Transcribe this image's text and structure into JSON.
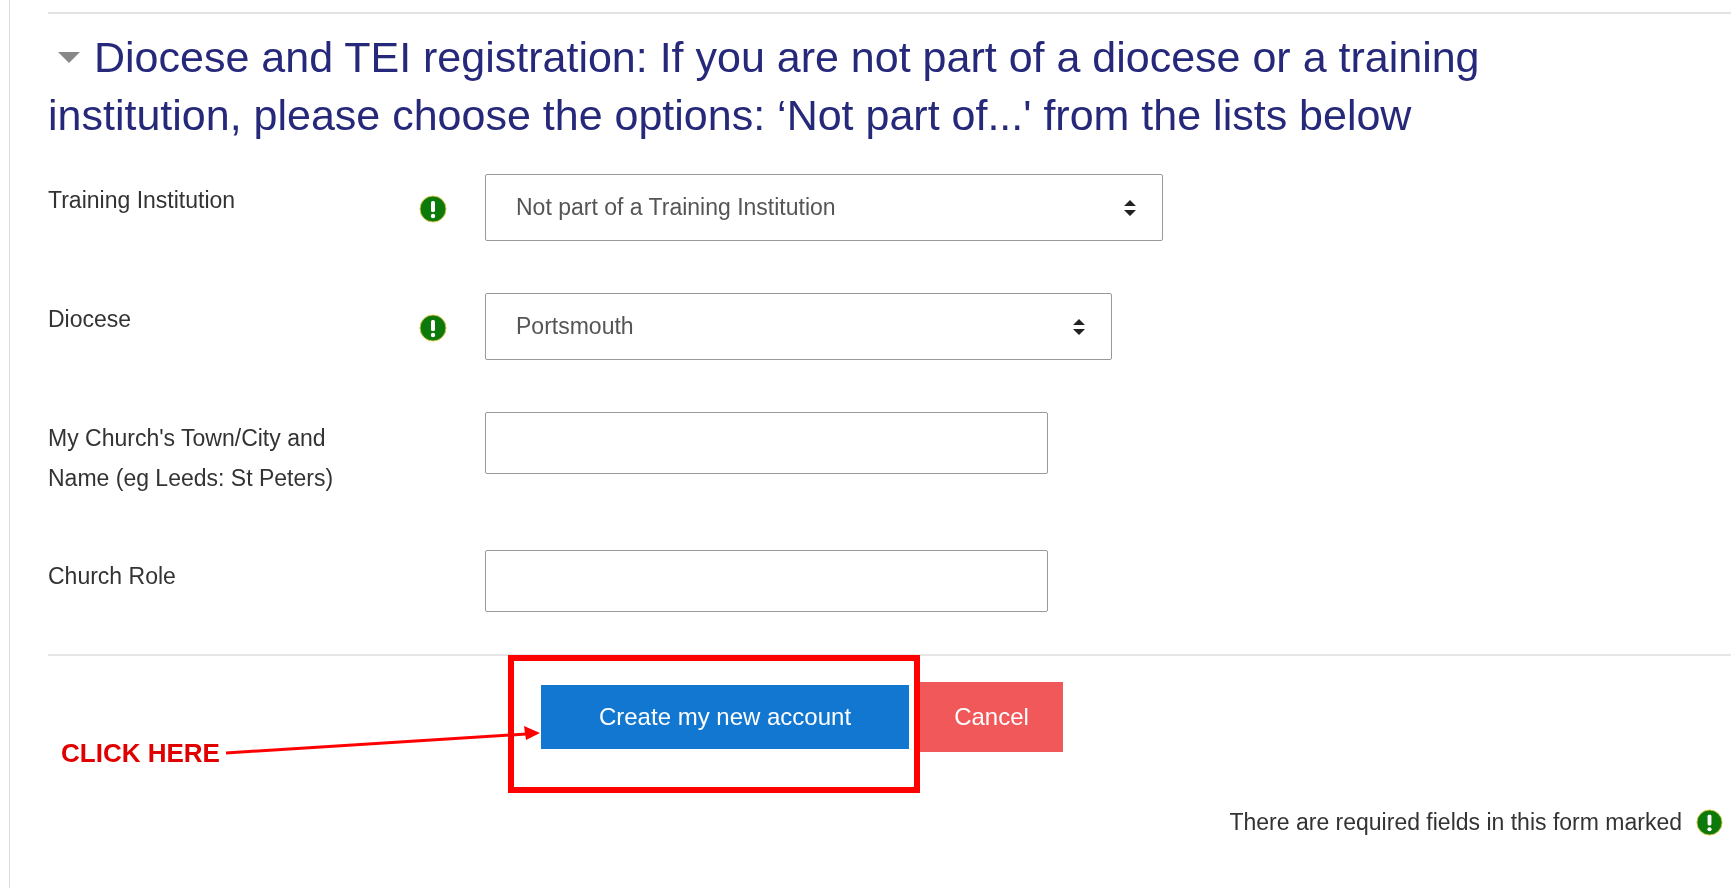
{
  "section": {
    "expanded": true,
    "title": "Diocese and TEI registration: If you are not part of a diocese or a training institution, please choose the options: ‘Not part of...' from the lists below"
  },
  "fields": [
    {
      "kind": "select",
      "label": "Training Institution",
      "required": true,
      "value": "Not part of a Training Institution"
    },
    {
      "kind": "select",
      "label": "Diocese",
      "required": true,
      "value": "Portsmouth"
    },
    {
      "kind": "text",
      "label": "My Church's Town/City and Name (eg Leeds: St Peters)",
      "required": false
    },
    {
      "kind": "text",
      "label": "Church Role",
      "required": false
    }
  ],
  "buttons": [
    {
      "kind": "primary",
      "label": "Create my new account"
    },
    {
      "kind": "danger",
      "label": "Cancel"
    }
  ],
  "annotation": {
    "label": "CLICK HERE"
  },
  "footer_note": "There are required fields in this form marked"
}
